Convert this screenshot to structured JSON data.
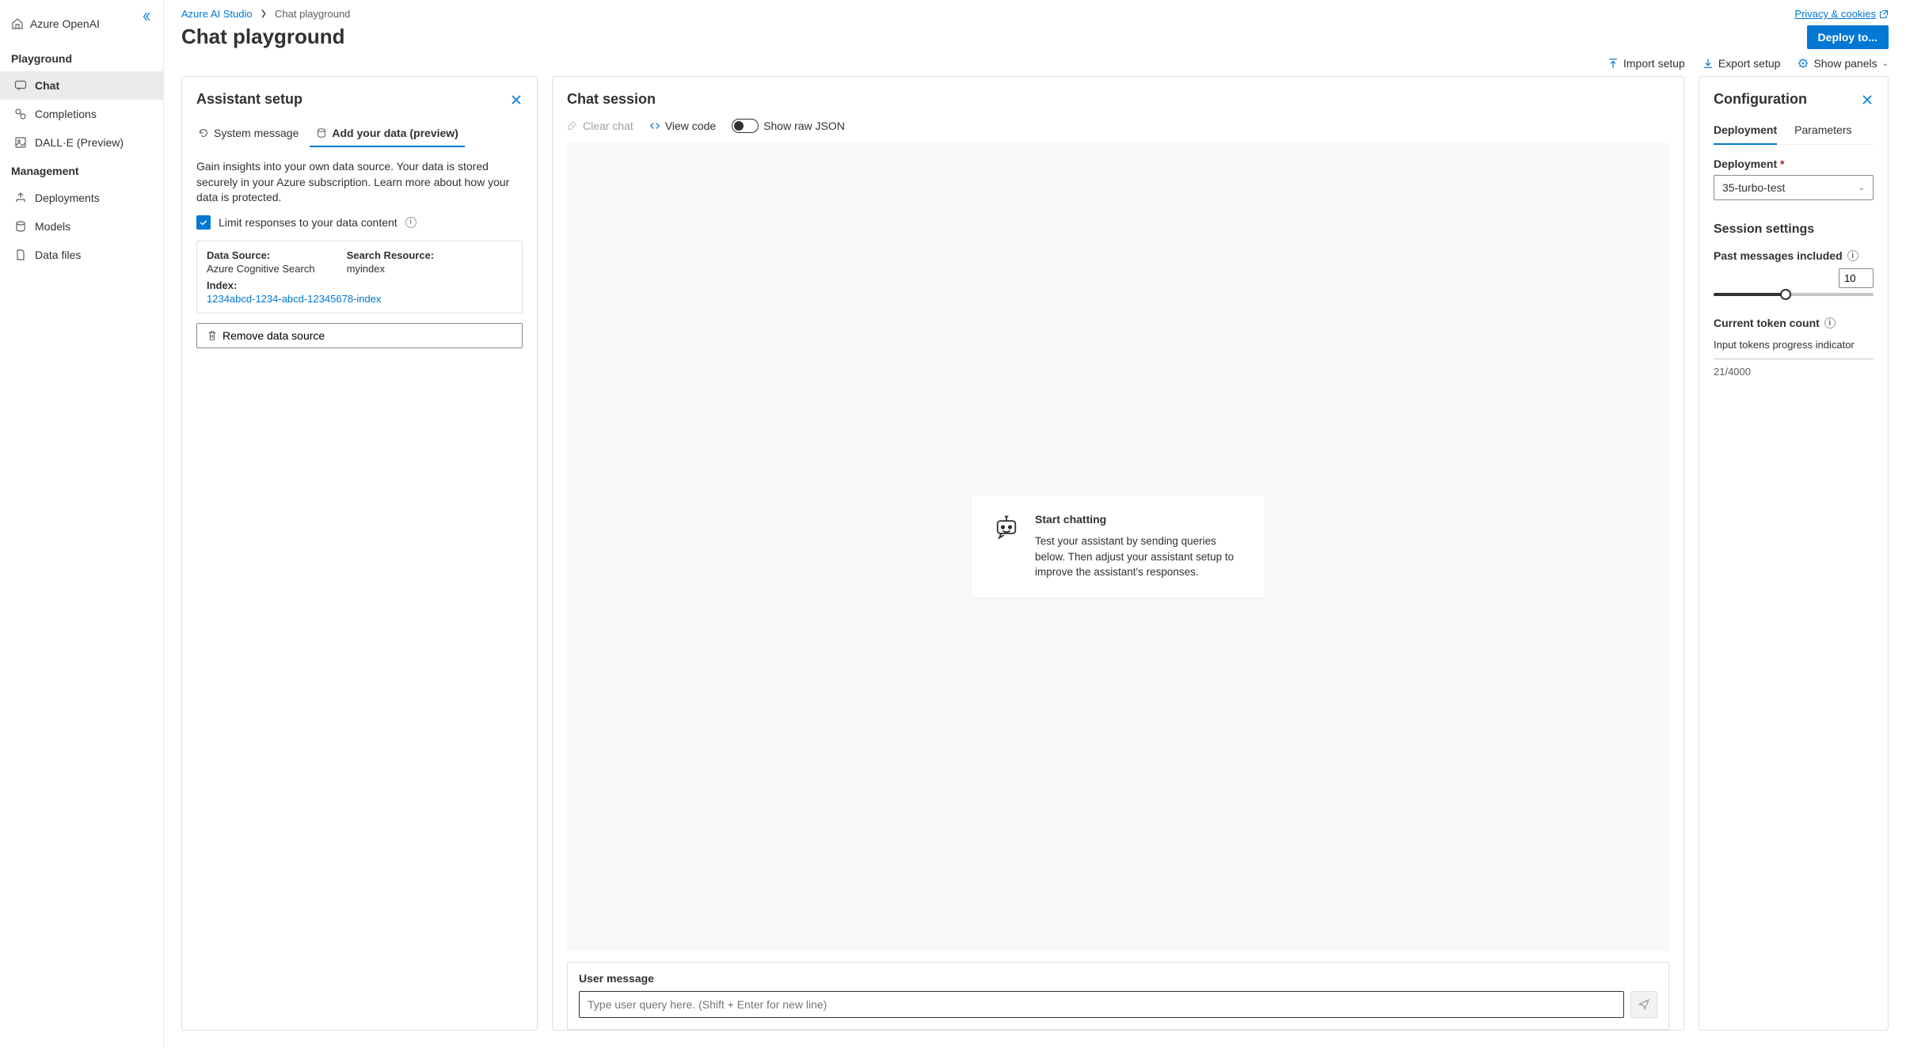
{
  "brand": "Azure OpenAI",
  "sidebar": {
    "sections": [
      {
        "title": "Playground",
        "items": [
          {
            "label": "Chat",
            "active": true
          },
          {
            "label": "Completions"
          },
          {
            "label": "DALL·E (Preview)"
          }
        ]
      },
      {
        "title": "Management",
        "items": [
          {
            "label": "Deployments"
          },
          {
            "label": "Models"
          },
          {
            "label": "Data files"
          }
        ]
      }
    ]
  },
  "breadcrumb": {
    "root": "Azure AI Studio",
    "current": "Chat playground"
  },
  "privacy_label": "Privacy & cookies",
  "page_title": "Chat playground",
  "deploy_label": "Deploy to...",
  "toolbar": {
    "import": "Import setup",
    "export": "Export setup",
    "show_panels": "Show panels"
  },
  "assistant": {
    "title": "Assistant setup",
    "tabs": {
      "system": "System message",
      "data": "Add your data (preview)"
    },
    "description": "Gain insights into your own data source. Your data is stored securely in your Azure subscription. Learn more about how your data is protected.",
    "limit_label": "Limit responses to your data content",
    "data_source_label": "Data Source:",
    "data_source_value": "Azure Cognitive Search",
    "search_resource_label": "Search Resource:",
    "search_resource_value": "myindex",
    "index_label": "Index:",
    "index_value": "1234abcd-1234-abcd-12345678-index",
    "remove_label": "Remove data source"
  },
  "chat": {
    "title": "Chat session",
    "clear": "Clear chat",
    "view_code": "View code",
    "show_json": "Show raw JSON",
    "hint_title": "Start chatting",
    "hint_body": "Test your assistant by sending queries below. Then adjust your assistant setup to improve the assistant's responses.",
    "input_label": "User message",
    "input_placeholder": "Type user query here. (Shift + Enter for new line)"
  },
  "config": {
    "title": "Configuration",
    "tabs": {
      "deployment": "Deployment",
      "parameters": "Parameters"
    },
    "deployment_label": "Deployment",
    "deployment_value": "35-turbo-test",
    "session_settings": "Session settings",
    "past_messages_label": "Past messages included",
    "past_messages_value": "10",
    "token_count_label": "Current token count",
    "token_sub_label": "Input tokens progress indicator",
    "token_readout": "21/4000"
  }
}
